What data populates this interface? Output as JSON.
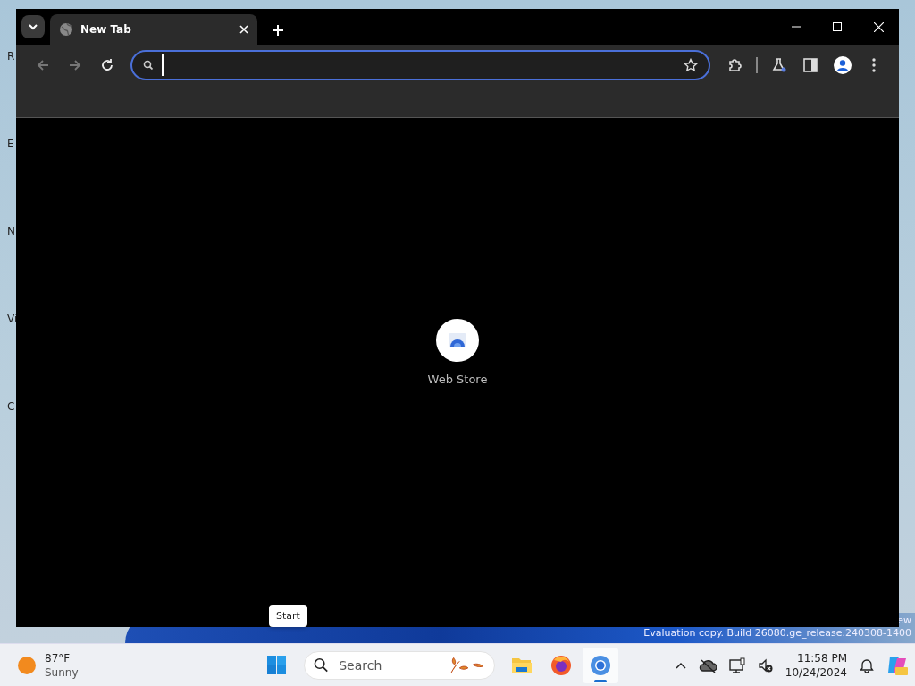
{
  "desktop": {
    "icon_labels": [
      "R",
      "E",
      "N",
      "Vi",
      "C"
    ],
    "watermark": [
      "ew",
      "Evaluation copy. Build 26080.ge_release.240308-1400"
    ]
  },
  "browser": {
    "tabs": [
      {
        "title": "New Tab",
        "selected": true
      }
    ],
    "nav": [
      {
        "kind": "back",
        "disabled": true
      },
      {
        "kind": "forward",
        "disabled": true
      },
      {
        "kind": "reload",
        "disabled": false
      }
    ],
    "omnibox": {
      "focused": true
    },
    "shortcuts": [
      {
        "label": "Web Store"
      }
    ]
  },
  "tooltip": "Start",
  "taskbar": {
    "weather": {
      "temp": "87°F",
      "condition": "Sunny"
    },
    "search_placeholder": "Search",
    "apps": [
      {
        "kind": "start",
        "running": false
      },
      {
        "kind": "files",
        "running": false
      },
      {
        "kind": "firefox",
        "running": false
      },
      {
        "kind": "chromium",
        "running": true
      }
    ],
    "clock": {
      "time": "11:58 PM",
      "date": "10/24/2024"
    }
  }
}
